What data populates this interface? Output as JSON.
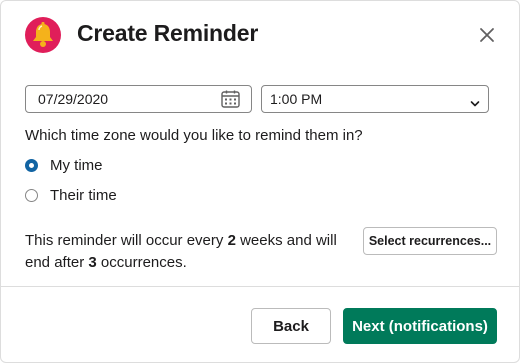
{
  "header": {
    "title": "Create Reminder",
    "logo_icon": "bell-icon",
    "close_icon": "close-icon"
  },
  "datetime": {
    "date_value": "07/29/2020",
    "calendar_icon": "calendar-icon",
    "time_value": "1:00 PM",
    "time_dropdown_icon": "chevron-down-icon"
  },
  "timezone": {
    "question": "Which time zone would you like to remind them in?",
    "options": [
      {
        "label": "My time",
        "selected": true
      },
      {
        "label": "Their time",
        "selected": false
      }
    ]
  },
  "recurrence": {
    "text_before_interval": "This reminder will occur every ",
    "interval": "2",
    "text_after_interval": " weeks and will end after ",
    "count": "3",
    "text_after_count": " occurrences.",
    "button_label": "Select recurrences..."
  },
  "footer": {
    "back_label": "Back",
    "next_label": "Next (notifications)"
  },
  "colors": {
    "logo_bg": "#e01e5a",
    "bell": "#f5b21b",
    "radio_selected": "#1264a3",
    "primary_button": "#007a5a"
  }
}
